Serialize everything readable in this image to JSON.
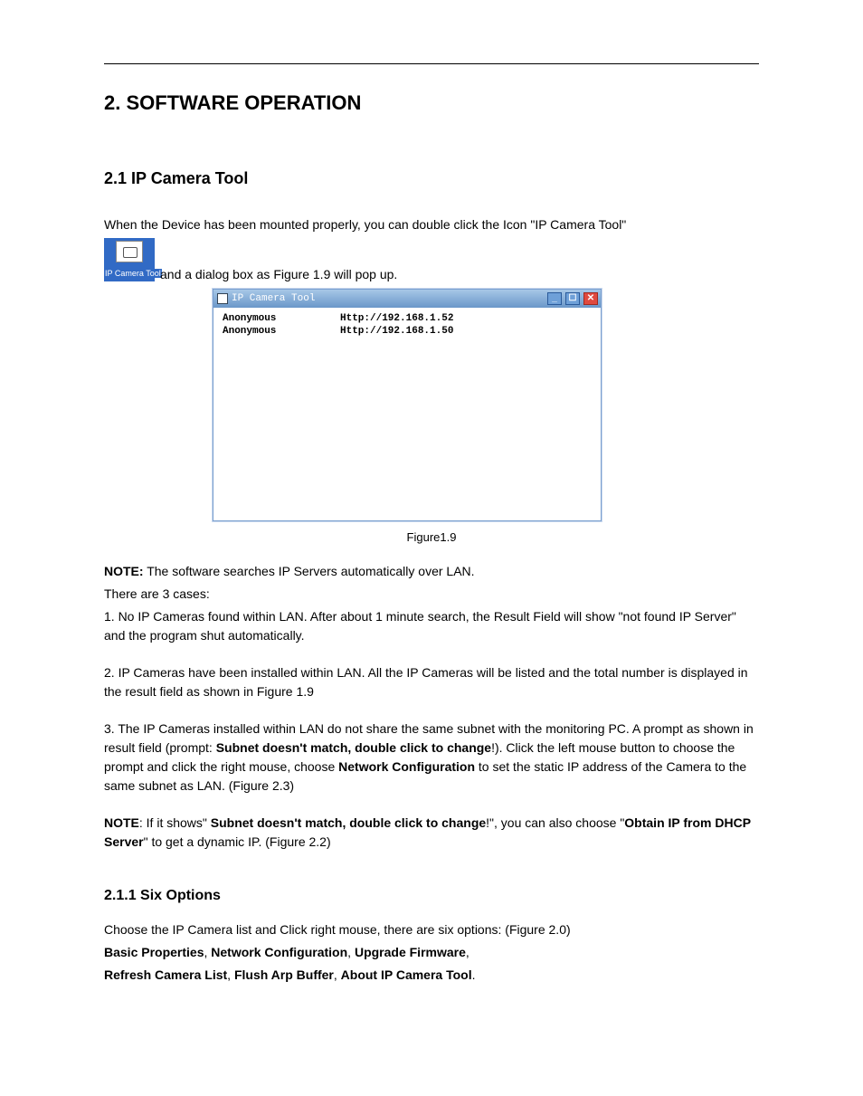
{
  "page": {
    "h1": "2. SOFTWARE OPERATION",
    "h2": "2.1 IP Camera Tool",
    "intro_before_icon": "When the Device has been mounted properly, you can double click the Icon \"IP Camera Tool\"",
    "desktop_icon_label": "IP Camera Tool",
    "intro_after_icon": " and a dialog box as Figure 1.9 will pop up.",
    "figure_caption": "Figure1.9",
    "dialog": {
      "title": "IP Camera Tool",
      "rows": [
        {
          "name": "Anonymous",
          "url": "Http://192.168.1.52"
        },
        {
          "name": "Anonymous",
          "url": "Http://192.168.1.50"
        }
      ]
    },
    "note1_label": "NOTE:",
    "note1_text": " The software searches IP Servers automatically over LAN.",
    "cases_intro": "There are 3 cases:",
    "case1": "1. No IP Cameras found within LAN. After about 1 minute search, the Result Field will show \"not found IP Server\" and the program shut automatically.",
    "case2": "2. IP Cameras have been installed within LAN. All the IP Cameras will be listed and the total number is displayed in the result field as shown in Figure 1.9",
    "case3_a": "3. The IP Cameras installed within LAN do not share the same subnet with the monitoring PC. A prompt as shown in result field (prompt: ",
    "case3_b_bold": "Subnet doesn't match, double click to change",
    "case3_c": "!). Click the left mouse button to choose the prompt and click the right mouse, choose ",
    "case3_d_bold": "Network Configuration",
    "case3_e": " to set the static IP address of the Camera to the same subnet as LAN. (Figure 2.3)",
    "note2_a_bold": "NOTE",
    "note2_b": ": If it shows\" ",
    "note2_c_bold": "Subnet doesn't match, double click to change",
    "note2_d": "!\", you can also choose \"",
    "note2_e_bold": "Obtain IP from DHCP Server",
    "note2_f": "\" to get a dynamic IP. (Figure 2.2)",
    "h3": "2.1.1 Six Options",
    "sixopt_intro": "Choose the IP Camera list and Click right mouse, there are six options: (Figure 2.0)",
    "opt1": "Basic Properties",
    "opt2": "Network Configuration",
    "opt3": "Upgrade Firmware",
    "opt4": "Refresh Camera List",
    "opt5": "Flush Arp Buffer",
    "opt6": "About IP Camera Tool",
    "comma": ", ",
    "period": "."
  }
}
